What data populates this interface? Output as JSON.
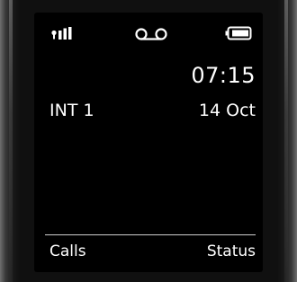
{
  "status_bar": {
    "signal_icon": "signal-strength-icon",
    "voicemail_icon": "voicemail-icon",
    "battery_icon": "battery-icon"
  },
  "idle_screen": {
    "time": "07:15",
    "handset_name": "INT 1",
    "date": "14 Oct"
  },
  "softkeys": {
    "left_label": "Calls",
    "right_label": "Status"
  }
}
